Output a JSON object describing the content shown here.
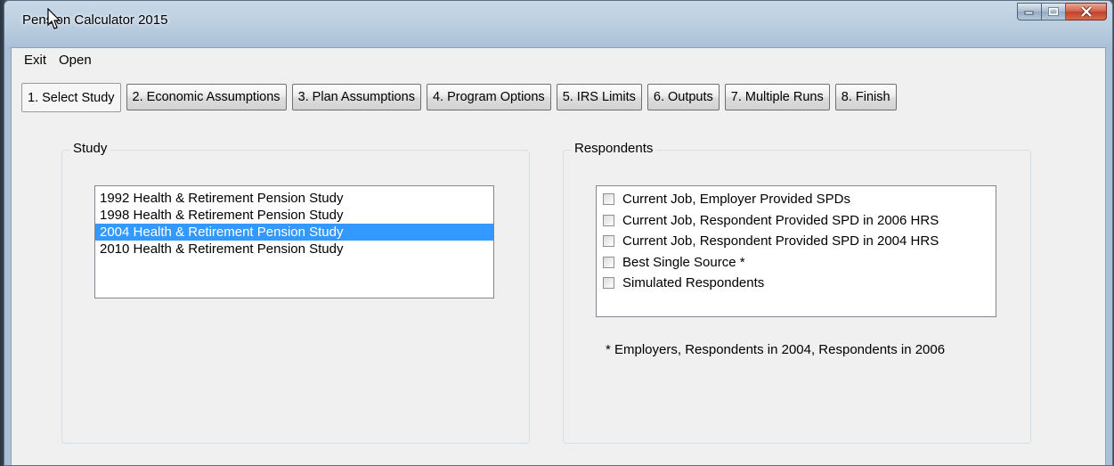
{
  "window": {
    "title": "Pension Calculator 2015"
  },
  "menu": [
    "Exit",
    "Open"
  ],
  "tabs": [
    "1. Select Study",
    "2. Economic Assumptions",
    "3. Plan Assumptions",
    "4. Program Options",
    "5. IRS Limits",
    "6. Outputs",
    "7. Multiple Runs",
    "8. Finish"
  ],
  "active_tab": "1. Select Study",
  "study": {
    "label": "Study",
    "items": [
      "1992 Health & Retirement Pension Study",
      "1998 Health & Retirement Pension Study",
      "2004 Health & Retirement Pension Study",
      "2010 Health & Retirement Pension Study"
    ],
    "selected": "2004 Health & Retirement Pension Study"
  },
  "respondents": {
    "label": "Respondents",
    "items": [
      {
        "label": "Current Job, Employer Provided SPDs",
        "checked": false
      },
      {
        "label": "Current Job, Respondent Provided SPD in 2006 HRS",
        "checked": false
      },
      {
        "label": "Current Job, Respondent Provided SPD in 2004 HRS",
        "checked": false
      },
      {
        "label": "Best Single Source *",
        "checked": false
      },
      {
        "label": "Simulated Respondents",
        "checked": false
      }
    ],
    "footnote": "* Employers, Respondents in 2004, Respondents in 2006"
  },
  "colors": {
    "selection": "#3399ff",
    "close_button": "#c24128",
    "client_bg": "#f0f0f0"
  },
  "icons": [
    "mouse-cursor-icon",
    "minimize-icon",
    "maximize-icon",
    "close-icon"
  ]
}
